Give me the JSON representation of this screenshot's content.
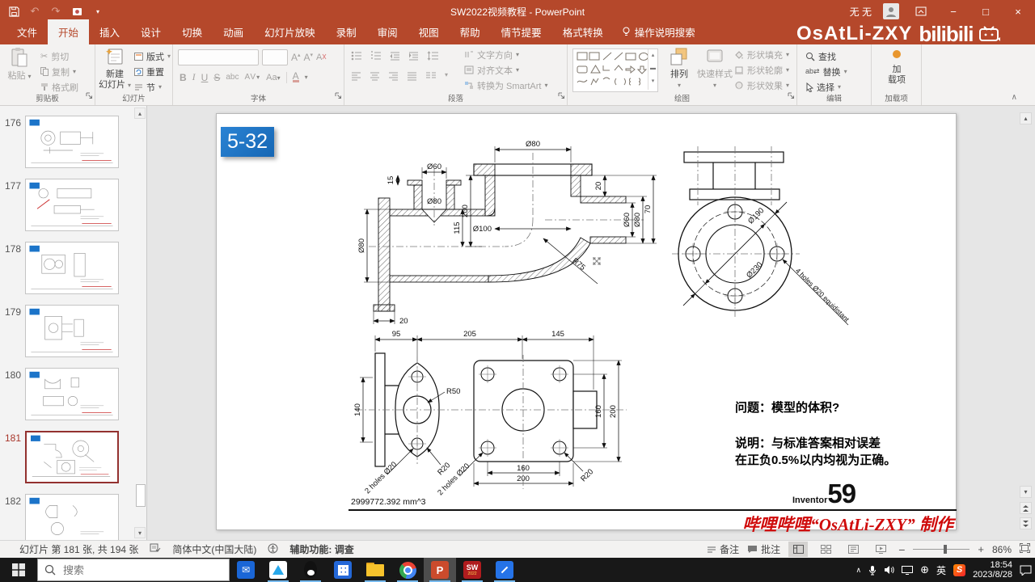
{
  "titlebar": {
    "title": "SW2022视频教程 - PowerPoint",
    "user_name": "无 无",
    "watermark_name": "OsAtLi-ZXY",
    "watermark_brand": "bilibili"
  },
  "icons": {
    "dropdown": "▾",
    "up": "▴",
    "down": "▾",
    "min": "−",
    "max": "□",
    "close": "×",
    "undo": "↶",
    "redo": "↷",
    "collapse": "∧",
    "chevron_up": "∧",
    "cut": "✂",
    "globe": "⊕",
    "replace_arrows": "⇄"
  },
  "tabs": {
    "items": [
      "文件",
      "开始",
      "插入",
      "设计",
      "切换",
      "动画",
      "幻灯片放映",
      "录制",
      "审阅",
      "视图",
      "帮助",
      "情节提要",
      "格式转换"
    ],
    "active": "开始",
    "tellme": "操作说明搜索"
  },
  "ribbon": {
    "clipboard": {
      "label": "剪贴板",
      "paste": "粘贴",
      "cut": "剪切",
      "copy": "复制",
      "painter": "格式刷"
    },
    "slides": {
      "label": "幻灯片",
      "new1": "新建",
      "new2": "幻灯片",
      "layout": "版式",
      "reset": "重置",
      "section": "节"
    },
    "font": {
      "label": "字体",
      "b": "B",
      "i": "I",
      "u": "U",
      "s": "S",
      "abc": "abc",
      "av": "AV",
      "aa": "Aa",
      "a": "A",
      "grow": "A",
      "shrink": "A"
    },
    "paragraph": {
      "label": "段落",
      "dir": "文字方向",
      "align": "对齐文本",
      "smartart": "转换为 SmartArt"
    },
    "drawing": {
      "label": "绘图",
      "arrange": "排列",
      "quick": "快速样式",
      "fill": "形状填充",
      "outline": "形状轮廓",
      "effects": "形状效果"
    },
    "editing": {
      "label": "编辑",
      "find": "查找",
      "replace": "替换",
      "select": "选择"
    },
    "addins": {
      "label": "加载项",
      "btn1": "加",
      "btn2": "载项"
    }
  },
  "thumbnails": {
    "items": [
      {
        "number": "176"
      },
      {
        "number": "177"
      },
      {
        "number": "178"
      },
      {
        "number": "179"
      },
      {
        "number": "180"
      },
      {
        "number": "181"
      },
      {
        "number": "182"
      }
    ],
    "selected": "181"
  },
  "slide": {
    "badge": "5-32",
    "question": "问题：模型的体积?",
    "note1": "说明：与标准答案相对误差",
    "note2": "在正负0.5%以内均视为正确。",
    "volume": "2999772.392 mm^3",
    "brand": "Inventor",
    "page_number": "59",
    "credit": "哔哩哔哩“OsAtLi-ZXY” 制作",
    "dims1": {
      "d80_top": "Ø80",
      "t20": "20",
      "h70": "70",
      "d60_r": "Ø60",
      "d80_r": "Ø80",
      "d60": "Ø60",
      "s15": "15",
      "d80_bore": "Ø80",
      "h115": "115",
      "h200": "200",
      "d100": "Ø100",
      "r75": "R75",
      "d80_l": "Ø80",
      "b20": "20"
    },
    "dims2": {
      "d190": "Ø190",
      "d230": "Ø230",
      "holes": "4 holes Ø20 equidistant"
    },
    "dims3": {
      "w95": "95",
      "w205": "205",
      "w145": "145",
      "h140": "140",
      "r50": "R50",
      "holes_a": "2 holes Ø20",
      "r20_a": "R20",
      "holes_b": "2 holes Ø20",
      "r20_b": "R20",
      "w160b": "160",
      "w200b": "200",
      "h160": "160",
      "h200": "200"
    }
  },
  "statusbar": {
    "slide_info": "幻灯片 第 181 张, 共 194 张",
    "language": "简体中文(中国大陆)",
    "accessibility": "辅助功能: 调查",
    "notes": "备注",
    "comments": "批注",
    "zoom_level": "86%"
  },
  "taskbar": {
    "search_placeholder": "搜索",
    "ime": "英",
    "sogou": "S",
    "time": "18:54",
    "date": "2023/8/28",
    "ppt": "P",
    "sw": "SW",
    "sw_year": "2022"
  }
}
